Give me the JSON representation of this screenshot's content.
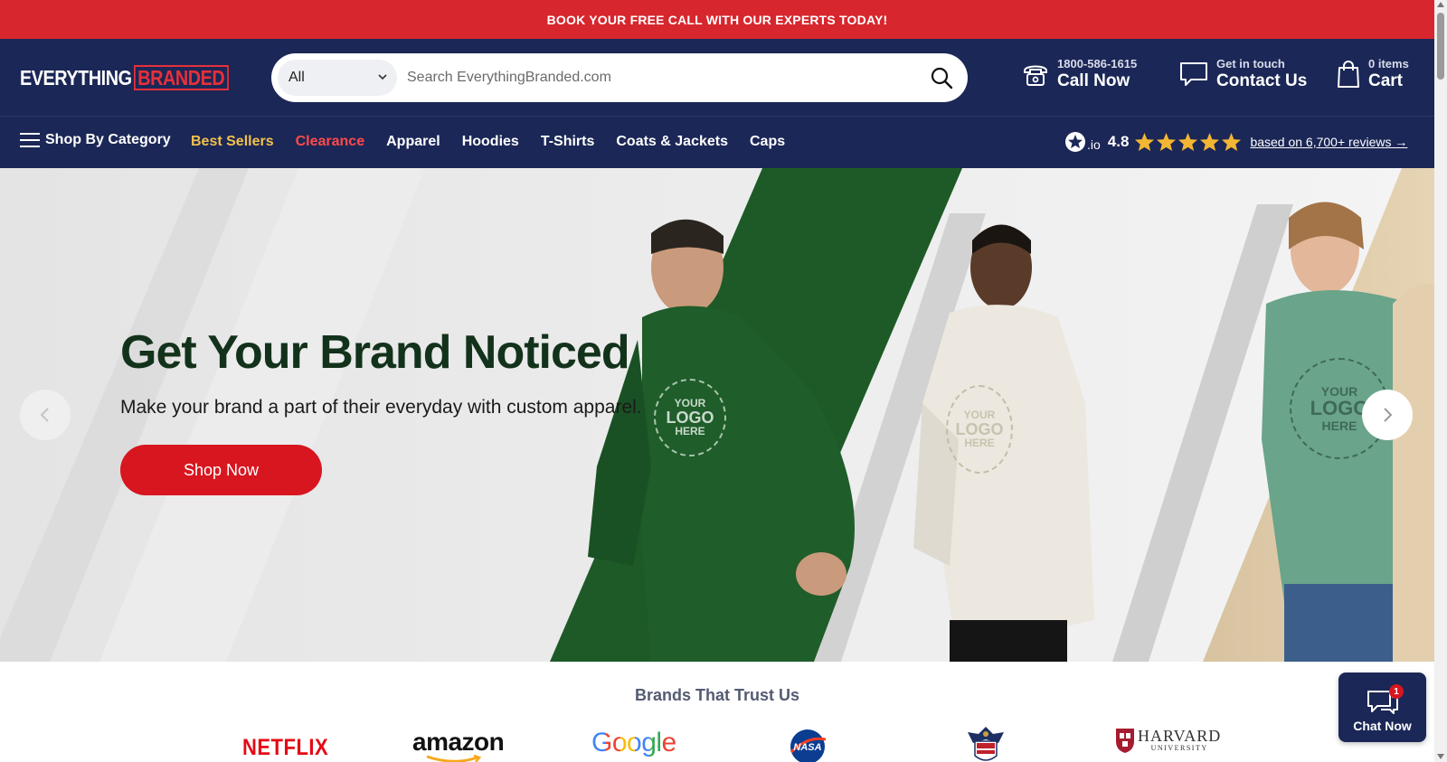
{
  "announcement": {
    "text": "BOOK YOUR FREE CALL WITH OUR EXPERTS TODAY!"
  },
  "brand": {
    "logo_part1": "EVERYTHING",
    "logo_part2": "BRANDED"
  },
  "search": {
    "category_selected": "All",
    "placeholder": "Search EverythingBranded.com",
    "value": ""
  },
  "header": {
    "phone": {
      "small": "1800-586-1615",
      "big": "Call Now",
      "icon": "phone-icon"
    },
    "contact": {
      "small": "Get in touch",
      "big": "Contact Us",
      "icon": "chat-bubble-icon"
    },
    "cart": {
      "small": "0 items",
      "big": "Cart",
      "icon": "shopping-bag-icon"
    }
  },
  "nav": {
    "category_label": "Shop By Category",
    "links": [
      {
        "label": "Best Sellers",
        "style": "gold"
      },
      {
        "label": "Clearance",
        "style": "red"
      },
      {
        "label": "Apparel",
        "style": "default"
      },
      {
        "label": "Hoodies",
        "style": "default"
      },
      {
        "label": "T-Shirts",
        "style": "default"
      },
      {
        "label": "Coats & Jackets",
        "style": "default"
      },
      {
        "label": "Caps",
        "style": "default"
      }
    ],
    "rating": {
      "io_suffix": ".io",
      "score": "4.8",
      "stars": 5,
      "reviews_link": "based on 6,700+ reviews →"
    }
  },
  "hero": {
    "title": "Get Your Brand Noticed",
    "subtitle": "Make your brand a part of their everyday with custom apparel.",
    "cta": "Shop Now",
    "logo_placeholder": {
      "line1": "YOUR",
      "line2": "LOGO",
      "line3": "HERE"
    }
  },
  "brands": {
    "title": "Brands That Trust Us",
    "items": [
      {
        "name": "NETFLIX"
      },
      {
        "name": "amazon"
      },
      {
        "name": "Google"
      },
      {
        "name": "NASA"
      },
      {
        "name": "crest"
      },
      {
        "name": "HARVARD",
        "subtitle": "UNIVERSITY"
      }
    ]
  },
  "chat_widget": {
    "label": "Chat Now",
    "badge": "1"
  },
  "colors": {
    "navy": "#1b2756",
    "red": "#d7262e",
    "gold": "#f2c14e",
    "hero_title": "#13321b",
    "hoodie_green": "#1f5d2a"
  }
}
